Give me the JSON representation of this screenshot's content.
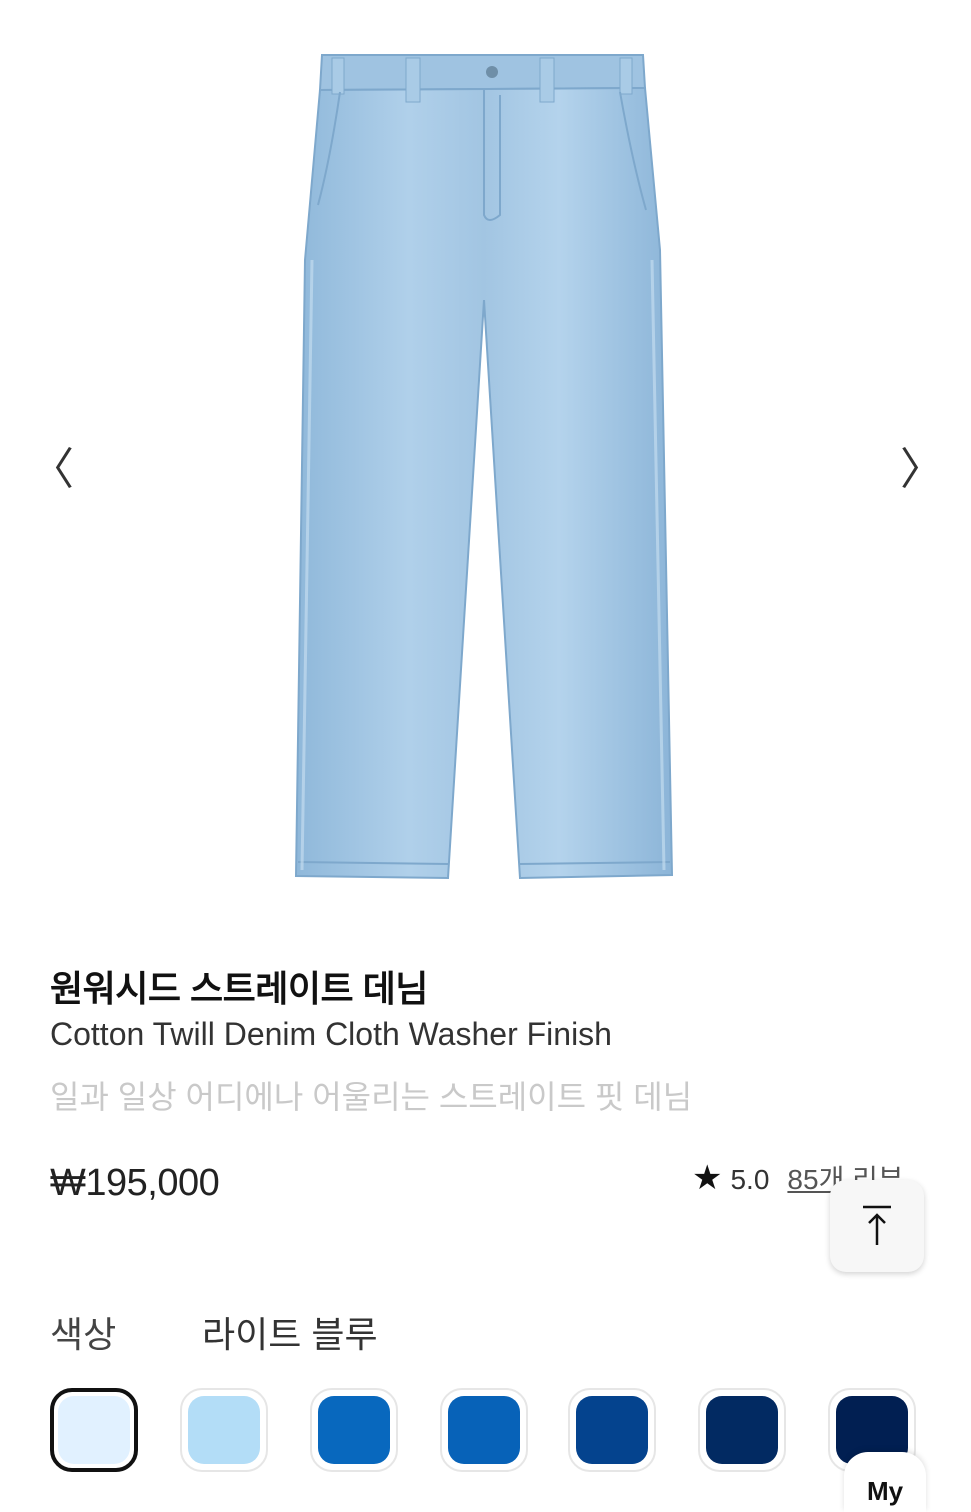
{
  "gallery": {
    "prev_arrow": "〈",
    "next_arrow": "〉"
  },
  "product": {
    "title_ko": "원워시드 스트레이트 데님",
    "title_en": "Cotton Twill Denim Cloth Washer Finish",
    "subtitle": "일과 일상 어디에나 어울리는 스트레이트 핏 데님",
    "price": "₩195,000",
    "rating": "5.0",
    "review_count": "85개 리뷰"
  },
  "color": {
    "label": "색상",
    "selected": "라이트 블루",
    "swatches": [
      {
        "name": "swatch-1",
        "color": "#e1f1ff"
      },
      {
        "name": "swatch-2",
        "color": "#b3ddf7"
      },
      {
        "name": "swatch-3",
        "color": "#0868be"
      },
      {
        "name": "swatch-4",
        "color": "#0762b8"
      },
      {
        "name": "swatch-5",
        "color": "#04438e"
      },
      {
        "name": "swatch-6",
        "color": "#022a62"
      },
      {
        "name": "swatch-7",
        "color": "#011f52"
      }
    ]
  },
  "floating": {
    "scroll_top_icon": "arrow-up-to-line-icon",
    "my_label": "My"
  },
  "colors": {
    "denim": "#9cc3e0",
    "denim_dark": "#7fa9cc"
  }
}
